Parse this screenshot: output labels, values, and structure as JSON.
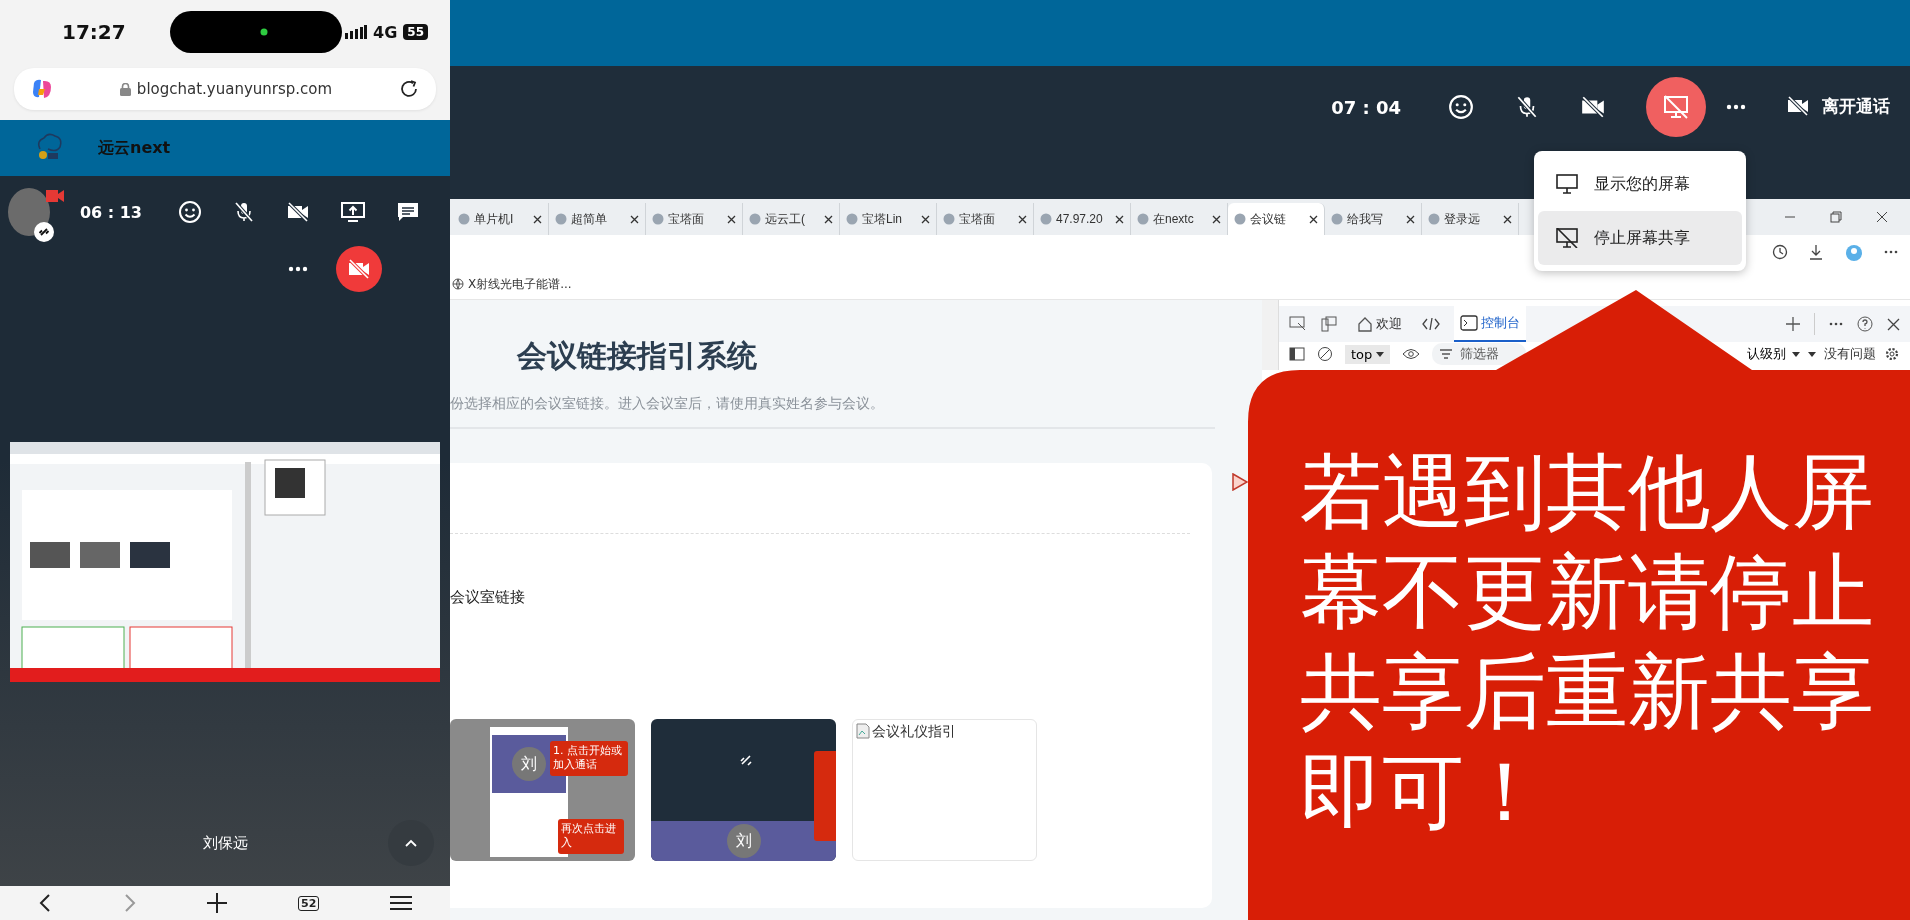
{
  "phone": {
    "status_time": "17:27",
    "network": "4G",
    "battery": "55",
    "url": "blogchat.yuanyunrsp.com",
    "app_title": "远云next",
    "call_timer": "06 : 13",
    "participant_name": "刘保远",
    "tab_count": "52"
  },
  "call_toolbar": {
    "timer": "07 : 04",
    "leave_label": "离开通话"
  },
  "share_menu": {
    "items": [
      {
        "label": "显示您的屏幕",
        "selected": false
      },
      {
        "label": "停止屏幕共享",
        "selected": true
      }
    ]
  },
  "browser": {
    "tabs": [
      {
        "label": "单片机I",
        "selected": false
      },
      {
        "label": "超简单",
        "selected": false
      },
      {
        "label": "宝塔面",
        "selected": false
      },
      {
        "label": "远云工(",
        "selected": false
      },
      {
        "label": "宝塔Lin",
        "selected": false
      },
      {
        "label": "宝塔面",
        "selected": false
      },
      {
        "label": "47.97.20",
        "selected": false
      },
      {
        "label": "在nextc",
        "selected": false
      },
      {
        "label": "会议链",
        "selected": true
      },
      {
        "label": "给我写",
        "selected": false
      },
      {
        "label": "登录远",
        "selected": false
      }
    ],
    "bookmark": "X射线光电子能谱...",
    "devtools": {
      "tabs": [
        {
          "label": "欢迎",
          "selected": false
        },
        {
          "label": "控制台",
          "selected": true
        }
      ],
      "context": "top",
      "filter_placeholder": "筛选器",
      "level": "认级别",
      "issues": "没有问题"
    }
  },
  "page": {
    "title": "会议链接指引系统",
    "subtitle": "份选择相应的会议室链接。进入会议室后，请使用真实姓名参与会议。",
    "section_label": "会议室链接",
    "thumbnails": [
      {
        "kind": "screenshot-light",
        "avatar": "刘",
        "notes": [
          "1. 点击开始或加入通话",
          "再次点击进入"
        ]
      },
      {
        "kind": "screenshot-dark",
        "avatar": "刘"
      },
      {
        "kind": "broken-image",
        "alt": "会议礼仪指引"
      }
    ]
  },
  "callout": {
    "text": "若遇到其他人屏幕不更新请停止共享后重新共享即可！"
  }
}
